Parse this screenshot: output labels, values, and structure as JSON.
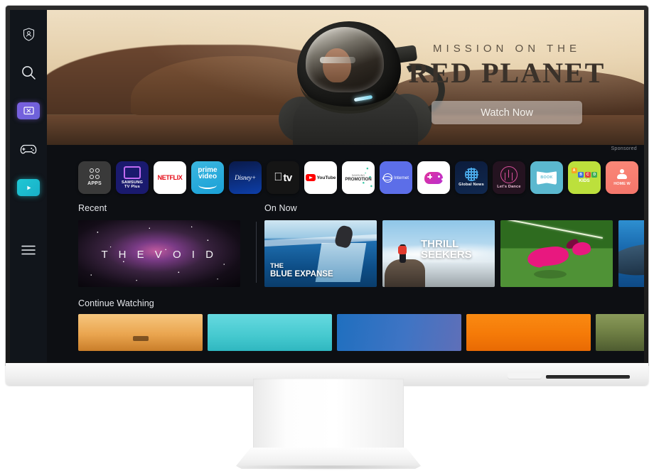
{
  "device": {
    "name": "samsung-smart-monitor",
    "bezel_color": "#f4f4f4"
  },
  "sidebar": {
    "items": [
      {
        "id": "profile",
        "icon": "shield-person-icon",
        "label": "Profile"
      },
      {
        "id": "search",
        "icon": "search-icon",
        "label": "Search"
      },
      {
        "id": "multiview",
        "icon": "tv-workspace-icon",
        "label": "Workspace"
      },
      {
        "id": "gaming",
        "icon": "gamepad-icon",
        "label": "Gaming Hub"
      },
      {
        "id": "media",
        "icon": "play-icon",
        "label": "Media"
      },
      {
        "id": "menu",
        "icon": "hamburger-menu-icon",
        "label": "Menu"
      }
    ]
  },
  "hero": {
    "kicker": "MISSION ON THE",
    "title": "RED PLANET",
    "button_label": "Watch Now",
    "sponsored_label": "Sponsored"
  },
  "apps": [
    {
      "id": "apps",
      "label": "APPS",
      "label2": ""
    },
    {
      "id": "samsung-tv-plus",
      "label": "SAMSUNG",
      "label2": "TV Plus"
    },
    {
      "id": "netflix",
      "label": "NETFLIX",
      "label2": ""
    },
    {
      "id": "prime-video",
      "label": "prime",
      "label2": "video"
    },
    {
      "id": "disney-plus",
      "label": "Disney+",
      "label2": ""
    },
    {
      "id": "apple-tv",
      "label": "tv",
      "label2": ""
    },
    {
      "id": "youtube",
      "label": "YouTube",
      "label2": ""
    },
    {
      "id": "samsung-promotion",
      "label": "PROMOTION",
      "label2": "SAMSUNG"
    },
    {
      "id": "internet",
      "label": "Internet",
      "label2": ""
    },
    {
      "id": "game-hub",
      "label": "",
      "label2": ""
    },
    {
      "id": "global-news",
      "label": "Global News",
      "label2": ""
    },
    {
      "id": "lets-dance",
      "label": "Let's Dance",
      "label2": ""
    },
    {
      "id": "book",
      "label": "BOOK",
      "label2": ""
    },
    {
      "id": "kids",
      "label": "KIDS",
      "label2": ""
    },
    {
      "id": "home-workout",
      "label": "HOME W",
      "label2": ""
    }
  ],
  "rows": {
    "recent": {
      "heading": "Recent",
      "card_title": "T H E   V O I D"
    },
    "on_now": {
      "heading": "On Now",
      "cards": [
        {
          "id": "blue-expanse",
          "line1": "THE",
          "line2": "BLUE EXPANSE"
        },
        {
          "id": "thrill-seekers",
          "line1": "THRILL",
          "line2": "SEEKERS"
        },
        {
          "id": "pink-dog",
          "line1": "",
          "line2": ""
        },
        {
          "id": "whale",
          "line1": "",
          "line2": ""
        }
      ]
    },
    "continue_watching": {
      "heading": "Continue Watching",
      "cards": [
        {
          "id": "cw-desert"
        },
        {
          "id": "cw-teal"
        },
        {
          "id": "cw-blue"
        },
        {
          "id": "cw-orange"
        },
        {
          "id": "cw-forest"
        }
      ]
    }
  }
}
